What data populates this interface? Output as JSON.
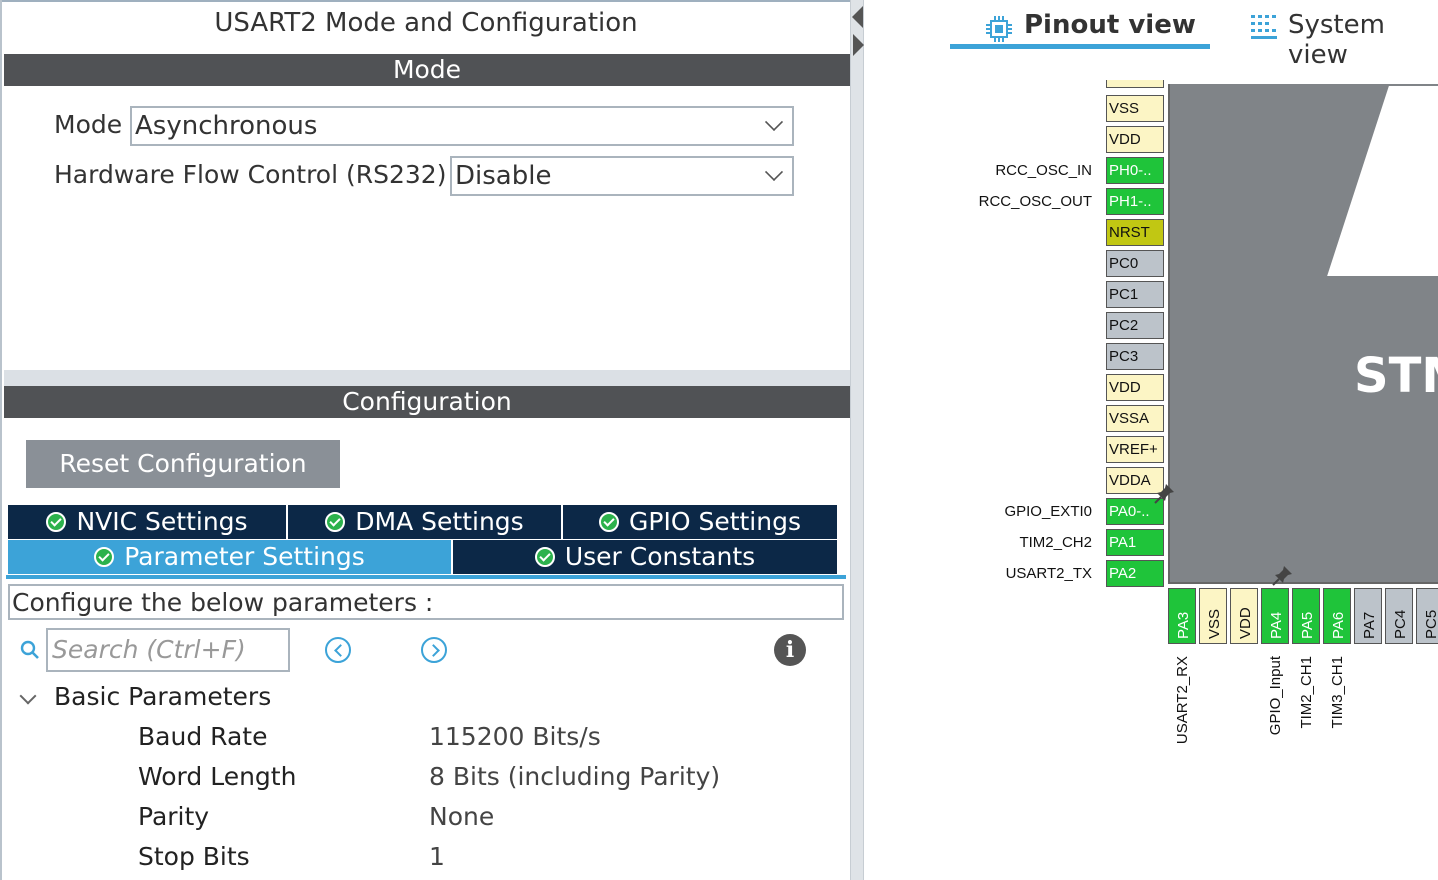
{
  "left_panel": {
    "title": "USART2 Mode and Configuration",
    "mode_section_label": "Mode",
    "mode_field": {
      "label": "Mode",
      "value": "Asynchronous"
    },
    "flow_field": {
      "label": "Hardware Flow Control (RS232)",
      "value": "Disable"
    },
    "config_section_label": "Configuration",
    "reset_button": "Reset Configuration",
    "tabs": [
      {
        "label": "NVIC Settings",
        "active": false
      },
      {
        "label": "DMA Settings",
        "active": false
      },
      {
        "label": "GPIO Settings",
        "active": false
      },
      {
        "label": "Parameter Settings",
        "active": true
      },
      {
        "label": "User Constants",
        "active": false
      }
    ],
    "description": "Configure the below parameters :",
    "search_placeholder": "Search (Ctrl+F)",
    "group": {
      "label": "Basic Parameters",
      "rows": [
        {
          "name": "Baud Rate",
          "value": "115200 Bits/s"
        },
        {
          "name": "Word Length",
          "value": "8 Bits (including Parity)"
        },
        {
          "name": "Parity",
          "value": "None"
        },
        {
          "name": "Stop Bits",
          "value": "1"
        }
      ]
    }
  },
  "right_panel": {
    "view_tabs": {
      "pinout": "Pinout view",
      "system": "System view"
    },
    "chip_label": "STM",
    "left_pins": [
      {
        "label": "VSS",
        "color": "yellow",
        "signal": ""
      },
      {
        "label": "VDD",
        "color": "yellow",
        "signal": ""
      },
      {
        "label": "PH0-..",
        "color": "green",
        "signal": "RCC_OSC_IN"
      },
      {
        "label": "PH1-..",
        "color": "green",
        "signal": "RCC_OSC_OUT"
      },
      {
        "label": "NRST",
        "color": "olive",
        "signal": ""
      },
      {
        "label": "PC0",
        "color": "gray",
        "signal": ""
      },
      {
        "label": "PC1",
        "color": "gray",
        "signal": ""
      },
      {
        "label": "PC2",
        "color": "gray",
        "signal": ""
      },
      {
        "label": "PC3",
        "color": "gray",
        "signal": ""
      },
      {
        "label": "VDD",
        "color": "yellow",
        "signal": ""
      },
      {
        "label": "VSSA",
        "color": "yellow",
        "signal": ""
      },
      {
        "label": "VREF+",
        "color": "yellow",
        "signal": ""
      },
      {
        "label": "VDDA",
        "color": "yellow",
        "signal": ""
      },
      {
        "label": "PA0-..",
        "color": "green",
        "signal": "GPIO_EXTI0"
      },
      {
        "label": "PA1",
        "color": "green",
        "signal": "TIM2_CH2"
      },
      {
        "label": "PA2",
        "color": "green",
        "signal": "USART2_TX"
      }
    ],
    "bottom_pins": [
      {
        "label": "PA3",
        "color": "green",
        "signal": "USART2_RX"
      },
      {
        "label": "VSS",
        "color": "yellow",
        "signal": ""
      },
      {
        "label": "VDD",
        "color": "yellow",
        "signal": ""
      },
      {
        "label": "PA4",
        "color": "green",
        "signal": "GPIO_Input"
      },
      {
        "label": "PA5",
        "color": "green",
        "signal": "TIM2_CH1"
      },
      {
        "label": "PA6",
        "color": "green",
        "signal": "TIM3_CH1"
      },
      {
        "label": "PA7",
        "color": "gray",
        "signal": ""
      },
      {
        "label": "PC4",
        "color": "gray",
        "signal": ""
      },
      {
        "label": "PC5",
        "color": "gray",
        "signal": ""
      }
    ]
  }
}
